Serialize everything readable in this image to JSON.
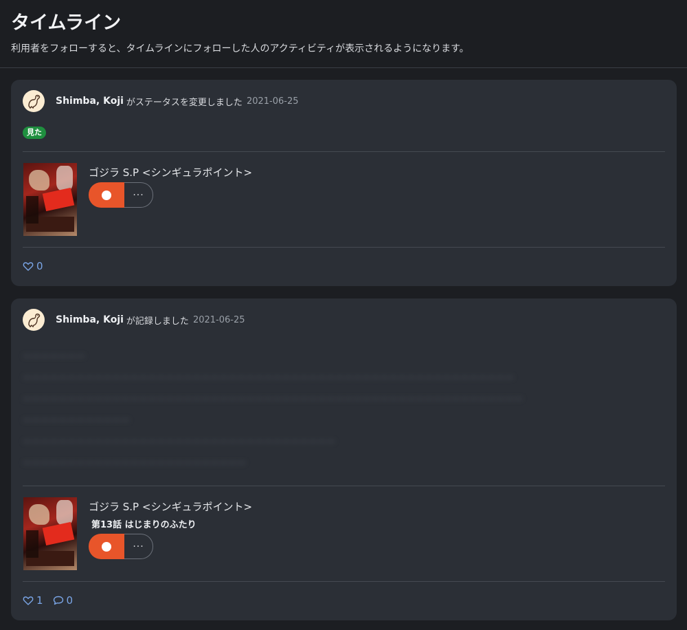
{
  "page": {
    "title": "タイムライン",
    "description": "利用者をフォローすると、タイムラインにフォローした人のアクティビティが表示されるようになります。"
  },
  "activities": [
    {
      "user_name": "Shimba, Koji",
      "action": "がステータスを変更しました",
      "date": "2021-06-25",
      "status_badge": "見た",
      "work_title": "ゴジラ S.P <シンギュラポイント>",
      "more_label": "···",
      "likes": "0"
    },
    {
      "user_name": "Shimba, Koji",
      "action": "が記録しました",
      "date": "2021-06-25",
      "body_lines": [
        "ーーーーーーー",
        "ーーーーーーーーーーーーーーーーーーーーーーーーーーーーーーーーーーーーーーーーーーーーーーーーーーーーーーー",
        "ーーーーーーーーーーーーーーーーーーーーーーーーーーーーーーーーーーーーーーーーーーーーーーーーーーーーーーーー",
        "ーーーーーーーーーーーー",
        "ーーーーーーーーーーーーーーーーーーーーーーーーーーーーーーーーーーー",
        "ーーーーーーーーーーーーーーーーーーーーーーーーー"
      ],
      "work_title": "ゴジラ S.P <シンギュラポイント>",
      "episode": "第13話 はじまりのふたり",
      "more_label": "···",
      "likes": "1",
      "comments": "0"
    }
  ],
  "colors": {
    "background": "#1c1e22",
    "card": "#2b2f36",
    "accent_orange": "#e8552a",
    "badge_green": "#1f8f3f",
    "link_blue": "#7aa5e6"
  },
  "icons": {
    "avatar": "dinosaur-avatar-icon",
    "like": "heart-icon",
    "comment": "comment-bubble-icon",
    "more": "ellipsis-icon"
  }
}
